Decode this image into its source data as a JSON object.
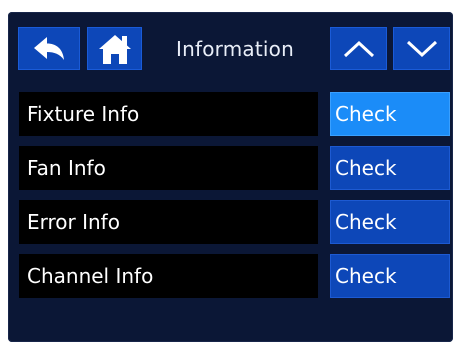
{
  "header": {
    "title": "Information",
    "back_icon": "back-arrow-icon",
    "home_icon": "home-icon",
    "up_icon": "chevron-up-icon",
    "down_icon": "chevron-down-icon"
  },
  "rows": [
    {
      "label": "Fixture Info",
      "action": "Check",
      "selected": true
    },
    {
      "label": "Fan Info",
      "action": "Check",
      "selected": false
    },
    {
      "label": "Error Info",
      "action": "Check",
      "selected": false
    },
    {
      "label": "Channel Info",
      "action": "Check",
      "selected": false
    }
  ],
  "colors": {
    "background": "#0b1736",
    "button": "#0d47b8",
    "button_selected": "#1b8cf8",
    "label_bg": "#000000",
    "text": "#ffffff"
  }
}
